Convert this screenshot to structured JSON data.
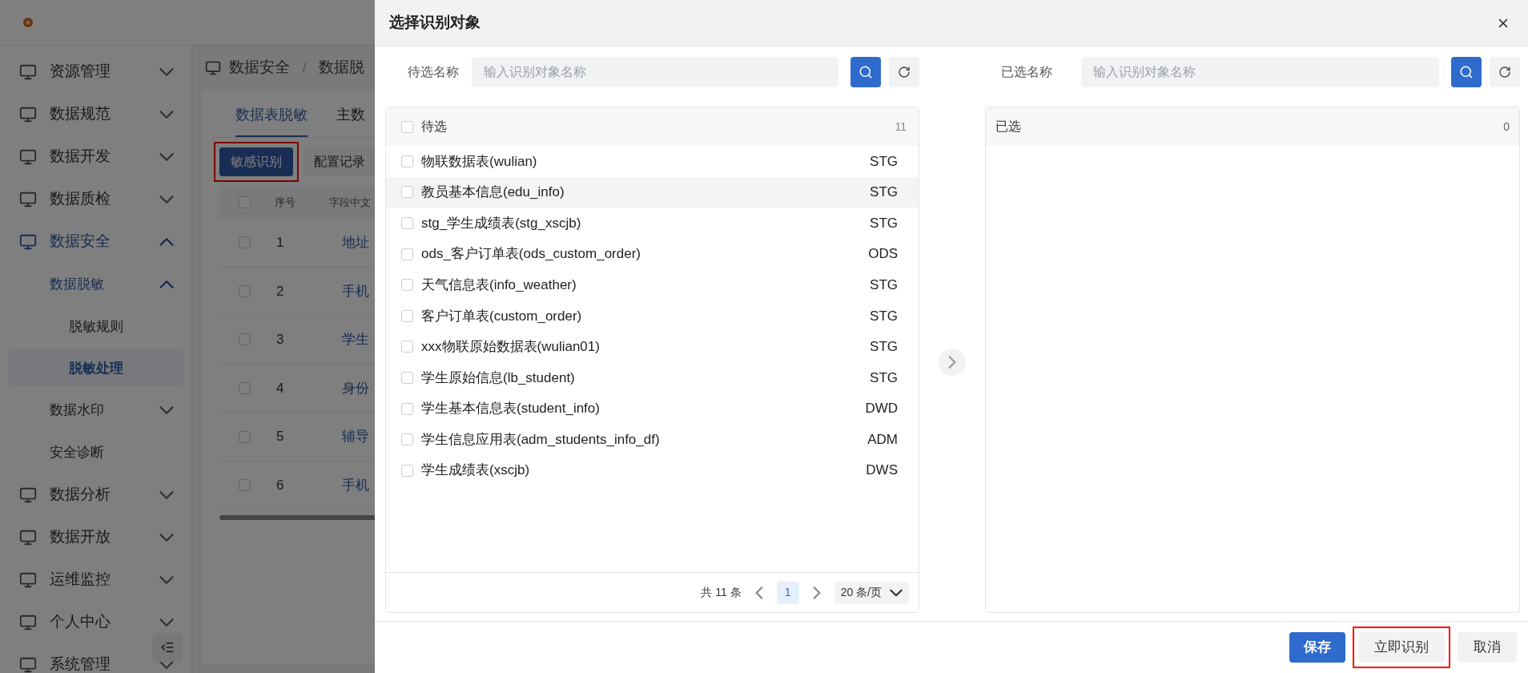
{
  "sidebar": {
    "items": [
      {
        "label": "资源管理",
        "expanded": false
      },
      {
        "label": "数据规范",
        "expanded": false
      },
      {
        "label": "数据开发",
        "expanded": false
      },
      {
        "label": "数据质检",
        "expanded": false
      },
      {
        "label": "数据安全",
        "expanded": true,
        "children": [
          {
            "label": "数据脱敏",
            "expanded": true,
            "children": [
              {
                "label": "脱敏规则",
                "selected": false
              },
              {
                "label": "脱敏处理",
                "selected": true
              }
            ]
          },
          {
            "label": "数据水印",
            "expanded": false
          },
          {
            "label": "安全诊断"
          }
        ]
      },
      {
        "label": "数据分析",
        "expanded": false
      },
      {
        "label": "数据开放",
        "expanded": false
      },
      {
        "label": "运维监控",
        "expanded": false
      },
      {
        "label": "个人中心",
        "expanded": false
      },
      {
        "label": "系统管理",
        "expanded": false
      }
    ]
  },
  "breadcrumb": {
    "separator": "/",
    "items": [
      "数据安全",
      "数据脱"
    ]
  },
  "tabs": [
    {
      "label": "数据表脱敏",
      "selected": true
    },
    {
      "label": "主数",
      "selected": false
    }
  ],
  "toolbar": [
    {
      "label": "敏感识别",
      "kind": "primary",
      "highlighted": true
    },
    {
      "label": "配置记录",
      "kind": "default",
      "highlighted": false
    }
  ],
  "table": {
    "columns": [
      "序号",
      "字段中文"
    ],
    "header_checked": false,
    "rows": [
      {
        "index": "1",
        "name": "地址",
        "checked": false
      },
      {
        "index": "2",
        "name": "手机",
        "checked": false
      },
      {
        "index": "3",
        "name": "学生",
        "checked": false
      },
      {
        "index": "4",
        "name": "身份",
        "checked": false
      },
      {
        "index": "5",
        "name": "辅导",
        "checked": false
      },
      {
        "index": "6",
        "name": "手机",
        "checked": false
      }
    ]
  },
  "dialog": {
    "title": "选择识别对象",
    "left": {
      "label": "待选名称",
      "placeholder": "输入识别对象名称",
      "list_title": "待选",
      "checked": false,
      "count": "11",
      "items": [
        {
          "name": "物联数据表(wulian)",
          "layer": "STG",
          "checked": false,
          "hovered": false
        },
        {
          "name": "教员基本信息(edu_info)",
          "layer": "STG",
          "checked": false,
          "hovered": true
        },
        {
          "name": "stg_学生成绩表(stg_xscjb)",
          "layer": "STG",
          "checked": false,
          "hovered": false
        },
        {
          "name": "ods_客户订单表(ods_custom_order)",
          "layer": "ODS",
          "checked": false,
          "hovered": false
        },
        {
          "name": "天气信息表(info_weather)",
          "layer": "STG",
          "checked": false,
          "hovered": false
        },
        {
          "name": "客户订单表(custom_order)",
          "layer": "STG",
          "checked": false,
          "hovered": false
        },
        {
          "name": "xxx物联原始数据表(wulian01)",
          "layer": "STG",
          "checked": false,
          "hovered": false
        },
        {
          "name": "学生原始信息(lb_student)",
          "layer": "STG",
          "checked": false,
          "hovered": false
        },
        {
          "name": "学生基本信息表(student_info)",
          "layer": "DWD",
          "checked": false,
          "hovered": false
        },
        {
          "name": "学生信息应用表(adm_students_info_df)",
          "layer": "ADM",
          "checked": false,
          "hovered": false
        },
        {
          "name": "学生成绩表(xscjb)",
          "layer": "DWS",
          "checked": false,
          "hovered": false
        }
      ],
      "pagination": {
        "total": "共 11 条",
        "pages": [
          {
            "label": "1",
            "selected": true
          }
        ],
        "page_size": "20 条/页"
      }
    },
    "right": {
      "label": "已选名称",
      "placeholder": "输入识别对象名称",
      "list_title": "已选",
      "count": "0"
    },
    "buttons": [
      {
        "label": "保存",
        "kind": "primary",
        "highlighted": false
      },
      {
        "label": "立即识别",
        "kind": "default",
        "highlighted": true
      },
      {
        "label": "取消",
        "kind": "default",
        "highlighted": false
      }
    ]
  }
}
